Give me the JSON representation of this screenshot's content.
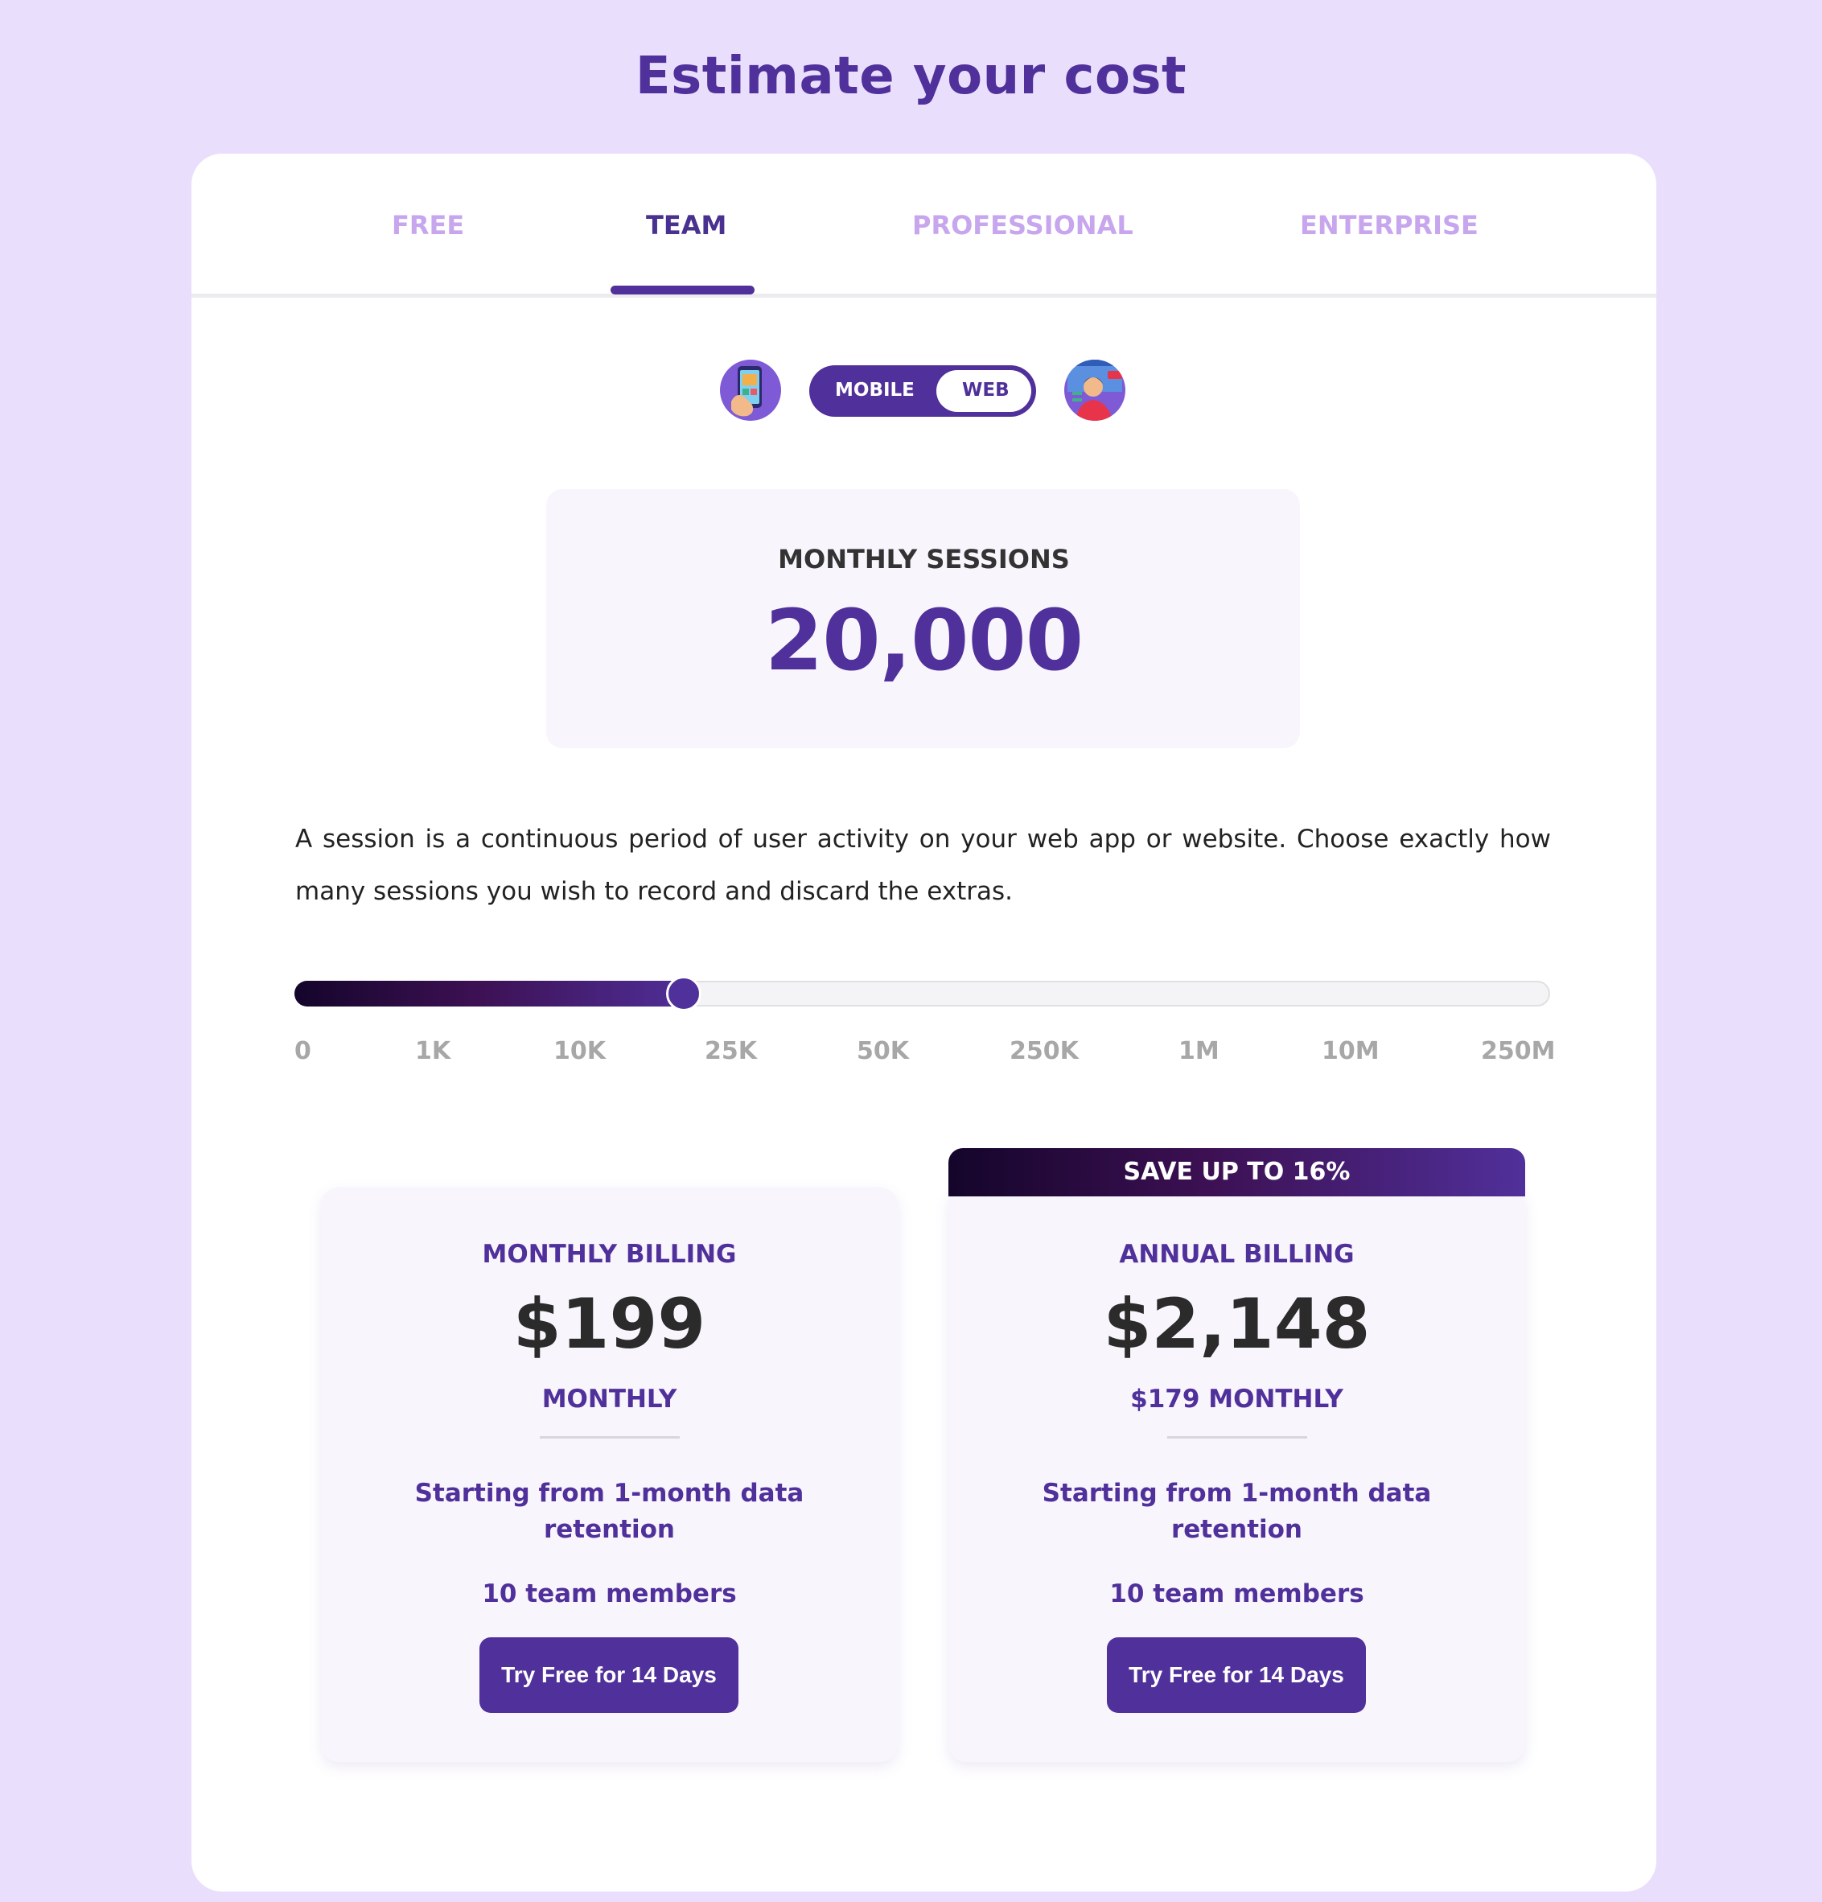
{
  "page": {
    "title": "Estimate your cost"
  },
  "tabs": [
    {
      "label": "FREE",
      "active": false
    },
    {
      "label": "TEAM",
      "active": true
    },
    {
      "label": "PROFESSIONAL",
      "active": false
    },
    {
      "label": "ENTERPRISE",
      "active": false
    }
  ],
  "platform_toggle": {
    "left_icon": "mobile-phone-icon",
    "right_icon": "live-web-session-icon",
    "options": [
      "MOBILE",
      "WEB"
    ],
    "selected": "WEB"
  },
  "sessions": {
    "label": "MONTHLY SESSIONS",
    "value": "20,000"
  },
  "description": "A session is a continuous period of user activity on your web app or website. Choose exactly how many sessions you wish to record and discard the extras.",
  "slider": {
    "ticks": [
      "0",
      "1K",
      "10K",
      "25K",
      "50K",
      "250K",
      "1M",
      "10M",
      "250M"
    ],
    "current_value": 20000
  },
  "billing": {
    "monthly": {
      "heading": "MONTHLY BILLING",
      "price": "$199",
      "sub": "MONTHLY",
      "retention": "Starting from 1-month data retention",
      "members": "10 team members",
      "button": "Try Free for 14 Days"
    },
    "annual": {
      "banner": "SAVE UP TO 16%",
      "heading": "ANNUAL BILLING",
      "price": "$2,148",
      "sub": "$179 MONTHLY",
      "retention": "Starting from 1-month data retention",
      "members": "10 team members",
      "button": "Try Free for 14 Days"
    }
  },
  "colors": {
    "accent": "#50309a",
    "background": "#e9dffd",
    "tab_inactive": "#c7a6ee"
  }
}
